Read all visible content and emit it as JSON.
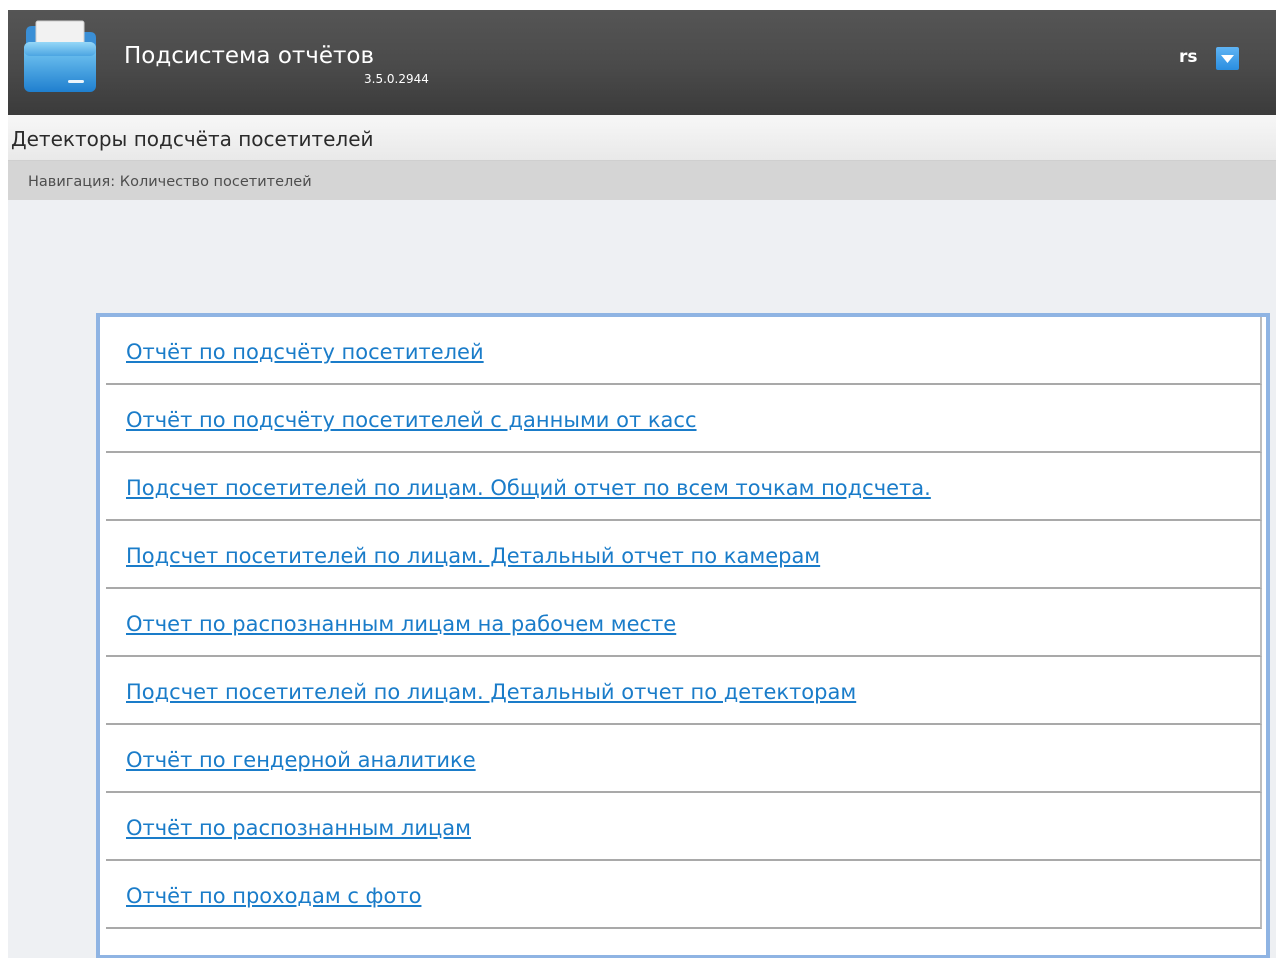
{
  "header": {
    "app_title": "Подсистема отчётов",
    "version": "3.5.0.2944",
    "user": "rs",
    "icons": {
      "app": "folder-icon",
      "user_menu": "chevron-down-icon"
    }
  },
  "section": {
    "title": "Детекторы подсчёта посетителей"
  },
  "breadcrumb": {
    "text": "Навигация: Количество посетителей"
  },
  "reports": [
    {
      "label": "Отчёт по подсчёту посетителей"
    },
    {
      "label": "Отчёт по подсчёту посетителей с данными от касс"
    },
    {
      "label": "Подсчет посетителей по лицам. Общий отчет по всем точкам подсчета."
    },
    {
      "label": "Подсчет посетителей по лицам. Детальный отчет по камерам"
    },
    {
      "label": "Отчет по распознанным лицам на рабочем месте"
    },
    {
      "label": "Подсчет посетителей по лицам. Детальный отчет по детекторам"
    },
    {
      "label": "Отчёт по гендерной аналитике"
    },
    {
      "label": "Отчёт по распознанным лицам"
    },
    {
      "label": "Отчёт по проходам с фото"
    }
  ],
  "colors": {
    "header": "#4a4a4a",
    "link": "#1a7cc9",
    "panel_border": "#8fb4e3",
    "accent": "#2a8ee0"
  }
}
